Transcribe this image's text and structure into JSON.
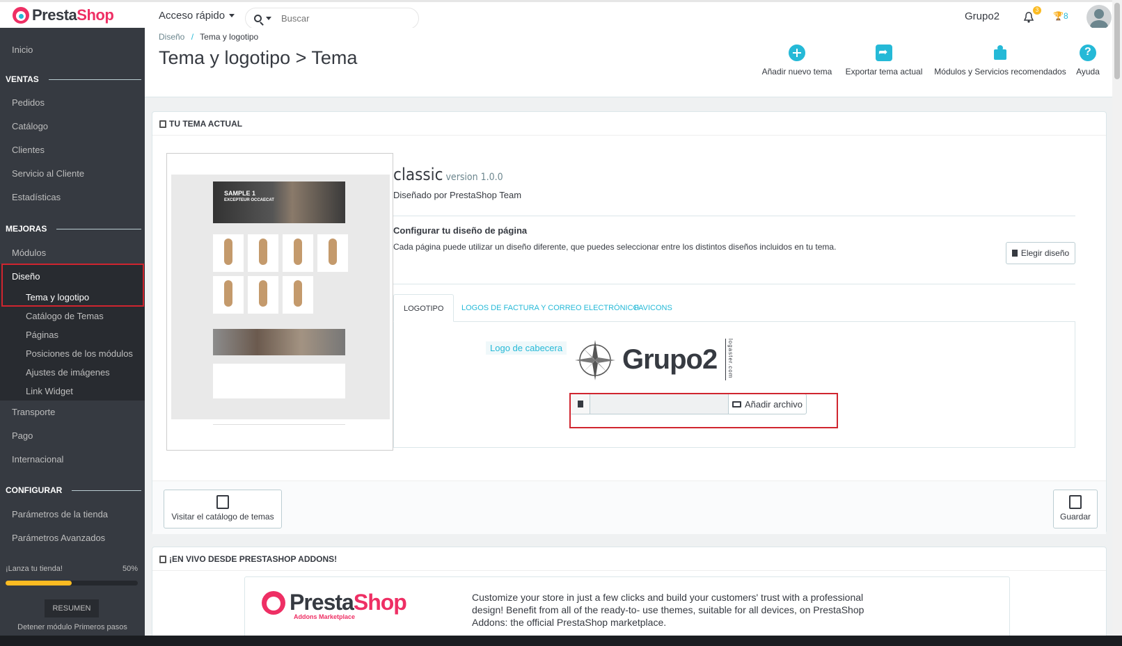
{
  "header": {
    "logo_part1": "Presta",
    "logo_part2": "Shop",
    "quick_access": "Acceso rápido",
    "search_placeholder": "Buscar",
    "shop_name": "Grupo2",
    "notif_count": "3",
    "trophy_count": "8"
  },
  "sidebar": {
    "home": "Inicio",
    "sections": {
      "ventas": "VENTAS",
      "mejoras": "MEJORAS",
      "configurar": "CONFIGURAR"
    },
    "ventas_items": [
      "Pedidos",
      "Catálogo",
      "Clientes",
      "Servicio al Cliente",
      "Estadísticas"
    ],
    "mejoras_items": [
      "Módulos",
      "Diseño"
    ],
    "diseno_sub": [
      "Tema y logotipo",
      "Catálogo de Temas",
      "Páginas",
      "Posiciones de los módulos",
      "Ajustes de imágenes",
      "Link Widget"
    ],
    "more_items": [
      "Transporte",
      "Pago",
      "Internacional"
    ],
    "configurar_items": [
      "Parámetros de la tienda",
      "Parámetros Avanzados"
    ],
    "launch_label": "¡Lanza tu tienda!",
    "launch_percent": "50%",
    "launch_progress": 0.5,
    "resumen": "RESUMEN",
    "stop": "Detener módulo Primeros pasos"
  },
  "page": {
    "breadcrumb_parent": "Diseño",
    "breadcrumb_sep": "/",
    "breadcrumb_current": "Tema y logotipo",
    "title": "Tema y logotipo > Tema",
    "toolbar": {
      "add_theme": "Añadir nuevo tema",
      "export_theme": "Exportar tema actual",
      "modules": "Módulos y Servicios recomendados",
      "help": "Ayuda"
    }
  },
  "theme_panel": {
    "heading": "TU TEMA ACTUAL",
    "preview": {
      "hero_title": "SAMPLE 1",
      "hero_sub": "EXCEPTEUR OCCAECAT"
    },
    "theme_name": "classic",
    "version": "version 1.0.0",
    "designed_by": "Diseñado por PrestaShop Team",
    "config_title": "Configurar tu diseño de página",
    "config_text": "Cada página puede utilizar un diseño diferente, que puedes seleccionar entre los distintos diseños incluidos en tu tema.",
    "choose_layout": "Elegir diseño",
    "tabs": [
      "LOGOTIPO",
      "LOGOS DE FACTURA Y CORREO ELECTRÓNICO",
      "FAVICONS"
    ],
    "logo_label": "Logo de cabecera",
    "brand_text": "Grupo2",
    "brand_side": "logaster.com",
    "add_file": "Añadir archivo",
    "visit_catalog": "Visitar el catálogo de temas",
    "save": "Guardar"
  },
  "addons_panel": {
    "heading": "¡EN VIVO DESDE PRESTASHOP ADDONS!",
    "brand_part1": "Presta",
    "brand_part2": "Shop",
    "brand_sub": "Addons Marketplace",
    "text": "Customize your store in just a few clicks and build your customers' trust with a professional design! Benefit from all of the ready-to- use themes, suitable for all devices, on PrestaShop Addons: the official PrestaShop marketplace."
  },
  "colors": {
    "accent": "#25b9d7",
    "brand_pink": "#ee2f64",
    "sidebar_bg": "#363a41",
    "highlight_red": "#d0252f",
    "progress_yellow": "#fbbb22"
  }
}
